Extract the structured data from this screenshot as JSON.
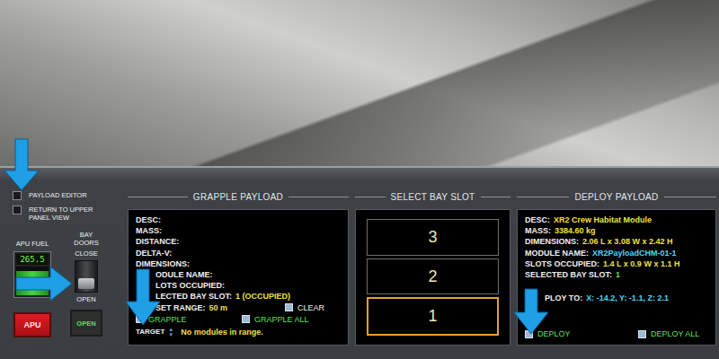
{
  "left_panel": {
    "checkboxes": [
      {
        "label": "PAYLOAD EDITOR",
        "checked": false
      },
      {
        "label": "RETURN TO UPPER PANEL VIEW",
        "checked": false
      }
    ],
    "apu_fuel": {
      "label": "APU FUEL",
      "reading": "265.5",
      "level": 0.85
    },
    "apu_button": {
      "label": "APU"
    },
    "bay_doors": {
      "label": "BAY DOORS",
      "close_label": "CLOSE",
      "open_label": "OPEN",
      "open": true,
      "indicator": "OPEN"
    }
  },
  "grapple": {
    "title": "GRAPPLE PAYLOAD",
    "lines": [
      {
        "label": "DESC:",
        "kind": "plain"
      },
      {
        "label": "MASS:",
        "kind": "plain"
      },
      {
        "label": "DISTANCE:",
        "kind": "plain"
      },
      {
        "label": "DELTA-V:",
        "kind": "plain"
      },
      {
        "label": "DIMENSIONS:",
        "kind": "plain"
      },
      {
        "label": "ODULE NAME:",
        "kind": "obscured"
      },
      {
        "label": "LOTS OCCUPIED:",
        "kind": "obscured"
      },
      {
        "label": "LECTED BAY SLOT:",
        "value": "1 (OCCUPIED)",
        "color": "#f0e040",
        "kind": "obscured"
      }
    ],
    "range": {
      "label": "SET RANGE:",
      "value": "50 m",
      "color": "#f0e040",
      "clear": {
        "label": "CLEAR",
        "checked": false,
        "color": "#f2f2f2"
      }
    },
    "actions": [
      {
        "label": "GRAPPLE",
        "checked": false,
        "color": "#5ce05c"
      },
      {
        "label": "GRAPPLE ALL",
        "checked": false,
        "color": "#5ce05c"
      }
    ],
    "target": {
      "label": "TARGET",
      "up": "▲",
      "down": "▼",
      "message": "No modules in range."
    }
  },
  "bay_slot": {
    "title": "SELECT BAY SLOT",
    "slots": [
      {
        "label": "3",
        "selected": false
      },
      {
        "label": "2",
        "selected": false
      },
      {
        "label": "1",
        "selected": true
      }
    ]
  },
  "deploy": {
    "title": "DEPLOY PAYLOAD",
    "lines": [
      {
        "label": "DESC:",
        "value": "XR2 Crew Habitat Module",
        "color": "#f0e040"
      },
      {
        "label": "MASS:",
        "value": "3384.60 kg",
        "color": "#f0e040"
      },
      {
        "label": "DIMENSIONS:",
        "value": "2.06 L x 3.08 W x 2.42 H",
        "color": "#f0e040"
      },
      {
        "label": "MODULE NAME:",
        "value": "XR2PayloadCHM-01-1",
        "color": "#4fd8f0"
      },
      {
        "label": "SLOTS OCCUPIED:",
        "value": "1.4 L x 0.9 W x 1.1 H",
        "color": "#f0e040"
      },
      {
        "label": "SELECTED BAY SLOT:",
        "value": "1",
        "color": "#5ce05c"
      }
    ],
    "deploy_to": {
      "label": "PLOY TO:",
      "value": "X: -14.2, Y: -1.1, Z: 2.1",
      "color": "#4fd8f0"
    },
    "actions": [
      {
        "label": "DEPLOY",
        "checked": false,
        "color": "#5ce05c"
      },
      {
        "label": "DEPLOY ALL",
        "checked": false,
        "color": "#5ce05c"
      }
    ]
  }
}
